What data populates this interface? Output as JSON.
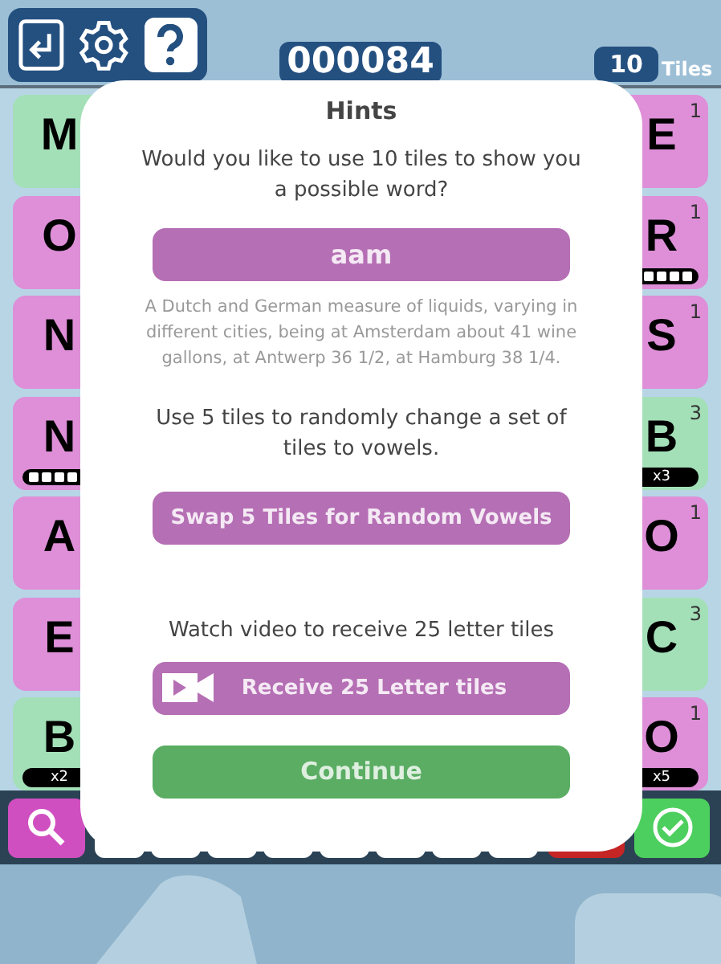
{
  "toolbar": {
    "score": "000084",
    "tile_count": "10",
    "tile_label": "Tiles"
  },
  "left_tiles": [
    {
      "letter": "M",
      "color": "#a3e0b8"
    },
    {
      "letter": "O",
      "color": "#de8fd8"
    },
    {
      "letter": "N",
      "color": "#de8fd8"
    },
    {
      "letter": "N",
      "color": "#de8fd8",
      "meter": true
    },
    {
      "letter": "A",
      "color": "#de8fd8"
    },
    {
      "letter": "E",
      "color": "#de8fd8"
    },
    {
      "letter": "B",
      "color": "#a3e0b8",
      "multiplier": "x2"
    }
  ],
  "right_tiles": [
    {
      "letter": "E",
      "points": "1",
      "color": "#de8fd8"
    },
    {
      "letter": "R",
      "points": "1",
      "color": "#de8fd8",
      "meter": true
    },
    {
      "letter": "S",
      "points": "1",
      "color": "#de8fd8"
    },
    {
      "letter": "B",
      "points": "3",
      "color": "#a3e0b8",
      "multiplier": "x3"
    },
    {
      "letter": "O",
      "points": "1",
      "color": "#de8fd8"
    },
    {
      "letter": "C",
      "points": "3",
      "color": "#a3e0b8"
    },
    {
      "letter": "O",
      "points": "1",
      "color": "#de8fd8",
      "multiplier": "x5"
    }
  ],
  "dialog": {
    "title": "Hints",
    "sections": [
      {
        "kind": "word",
        "prompt": "Would you like to use 10 tiles to show you a possible word?",
        "button": "aam",
        "definition": "A Dutch and German measure of liquids, varying in different cities, being at Amsterdam about 41 wine gallons, at Antwerp 36 1/2, at Hamburg 38 1/4."
      },
      {
        "kind": "swap",
        "prompt": "Use 5 tiles to randomly change a set of tiles to vowels.",
        "button": "Swap 5 Tiles for Random Vowels"
      },
      {
        "kind": "video",
        "prompt": "Watch video to receive 25 letter tiles",
        "button": "Receive 25 Letter tiles"
      }
    ],
    "continue": "Continue"
  }
}
